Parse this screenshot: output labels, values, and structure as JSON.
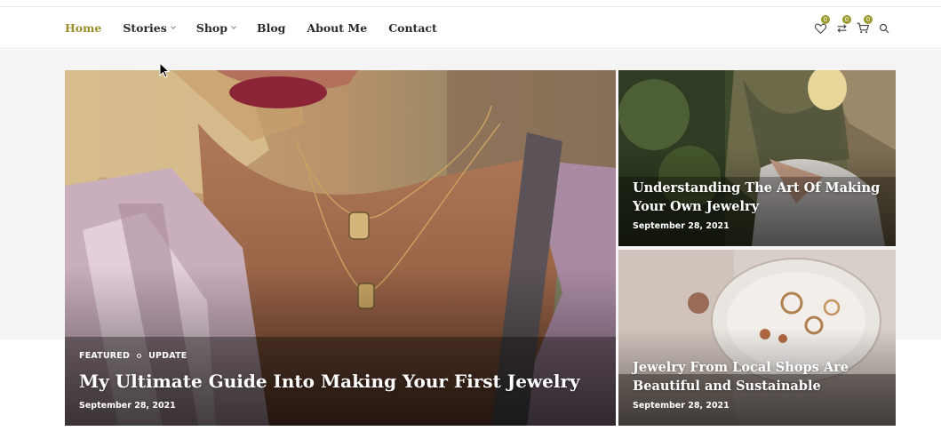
{
  "nav": {
    "items": [
      {
        "label": "Home",
        "active": true,
        "has_dropdown": false
      },
      {
        "label": "Stories",
        "active": false,
        "has_dropdown": true
      },
      {
        "label": "Shop",
        "active": false,
        "has_dropdown": true
      },
      {
        "label": "Blog",
        "active": false,
        "has_dropdown": false
      },
      {
        "label": "About Me",
        "active": false,
        "has_dropdown": false
      },
      {
        "label": "Contact",
        "active": false,
        "has_dropdown": false
      }
    ],
    "icons": {
      "wishlist": {
        "icon": "heart-icon",
        "count": "0"
      },
      "compare": {
        "icon": "compare-arrows-icon",
        "count": "0"
      },
      "cart": {
        "icon": "cart-icon",
        "count": "0"
      }
    },
    "search_icon": "search-icon"
  },
  "colors": {
    "accent": "#9b8f2c",
    "badge": "#9b9b2c",
    "text": "#2b2b2b",
    "band": "#f4f4f4"
  },
  "featured": {
    "categories": [
      "FEATURED",
      "UPDATE"
    ],
    "title": "My Ultimate Guide Into Making Your First Jewelry",
    "date": "September 28, 2021"
  },
  "side_posts": [
    {
      "title": "Understanding The Art Of Making Your Own Jewelry",
      "date": "September 28, 2021"
    },
    {
      "title": "Jewelry From Local Shops Are Beautiful and Sustainable",
      "date": "September 28, 2021"
    }
  ]
}
